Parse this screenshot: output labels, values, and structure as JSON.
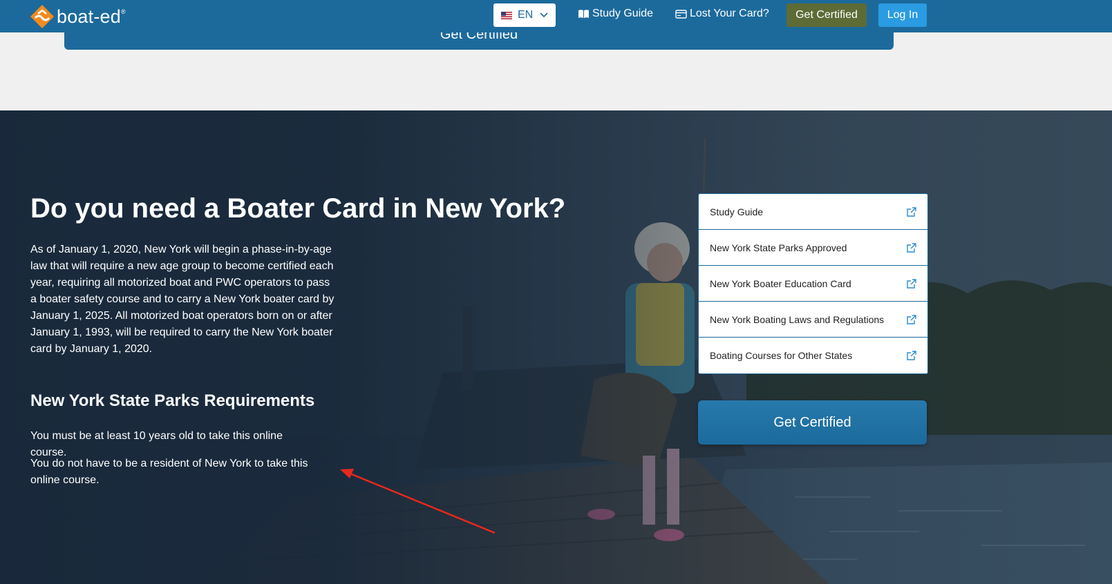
{
  "brand": {
    "name": "boat-ed",
    "reg": "®"
  },
  "nav": {
    "language": "EN",
    "study_guide": "Study Guide",
    "lost_card": "Lost Your Card?",
    "get_certified": "Get Certified",
    "login": "Log In"
  },
  "peek_button": {
    "label": "Get Certified"
  },
  "hero": {
    "title": "Do you need a Boater Card in New York?",
    "intro": "As of January 1, 2020, New York will begin a phase-in-by-age law that will require a new age group to become certified each year, requiring all motorized boat and PWC operators to pass a boater safety course and to carry a New York boater card by January 1, 2025. All motorized boat operators born on or after January 1, 1993, will be required to carry the New York boater card by January 1, 2020.",
    "requirements_title": "New York State Parks Requirements",
    "requirements": [
      "You must be at least 10 years old to take this online course.",
      "You do not have to be a resident of New York to take this online course."
    ]
  },
  "links": [
    {
      "label": "Study Guide"
    },
    {
      "label": "New York State Parks Approved"
    },
    {
      "label": "New York Boater Education Card"
    },
    {
      "label": "New York Boating Laws and Regulations"
    },
    {
      "label": "Boating Courses for Other States"
    }
  ],
  "cta": {
    "label": "Get Certified"
  },
  "colors": {
    "nav_bg": "#1c6a9c",
    "get_certified_bg": "#5d6b36",
    "login_bg": "#2b9be2",
    "hero_overlay": "#18283a",
    "annotation_arrow": "#e8281e"
  }
}
